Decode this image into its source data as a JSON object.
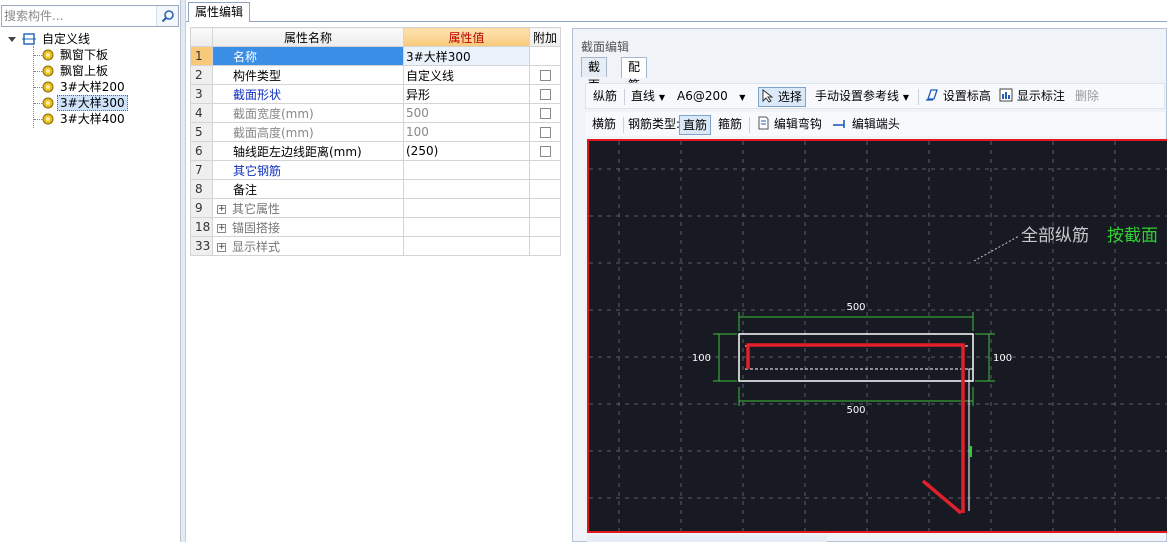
{
  "search": {
    "placeholder": "搜索构件..."
  },
  "tree": {
    "root_label": "自定义线",
    "items": [
      {
        "label": "飘窗下板"
      },
      {
        "label": "飘窗上板"
      },
      {
        "label": "3#大样200"
      },
      {
        "label": "3#大样300",
        "selected": true
      },
      {
        "label": "3#大样400"
      }
    ]
  },
  "tabs": {
    "property_edit": "属性编辑"
  },
  "grid": {
    "headers": {
      "name": "属性名称",
      "value": "属性值",
      "extra": "附加"
    },
    "rows": [
      {
        "num": "1",
        "name": "名称",
        "value": "3#大样300",
        "check": false
      },
      {
        "num": "2",
        "name": "构件类型",
        "value": "自定义线",
        "check": true
      },
      {
        "num": "3",
        "name": "截面形状",
        "value": "异形",
        "check": true
      },
      {
        "num": "4",
        "name": "截面宽度(mm)",
        "value": "500",
        "check": true
      },
      {
        "num": "5",
        "name": "截面高度(mm)",
        "value": "100",
        "check": true
      },
      {
        "num": "6",
        "name": "轴线距左边线距离(mm)",
        "value": "(250)",
        "check": true
      },
      {
        "num": "7",
        "name": "其它钢筋",
        "value": "",
        "check": false
      },
      {
        "num": "8",
        "name": "备注",
        "value": "",
        "check": false
      },
      {
        "num": "9",
        "name": "其它属性",
        "value": "",
        "check": false
      },
      {
        "num": "18",
        "name": "锚固搭接",
        "value": "",
        "check": false
      },
      {
        "num": "33",
        "name": "显示样式",
        "value": "",
        "check": false
      }
    ]
  },
  "section": {
    "title": "截面编辑",
    "tabs": [
      "截面",
      "配筋"
    ],
    "toolbar1": {
      "longitudinal": "纵筋",
      "line_mode": "直线",
      "rebar_spec": "A6@200",
      "select": "选择",
      "manual_ref": "手动设置参考线",
      "set_elevation": "设置标高",
      "show_label": "显示标注",
      "delete": "删除"
    },
    "toolbar2": {
      "transverse": "横筋",
      "rebar_type_label": "钢筋类型:",
      "straight": "直筋",
      "stirrup": "箍筋",
      "edit_hook": "编辑弯钩",
      "edit_end": "编辑端头"
    },
    "canvas": {
      "annotation_all": "全部纵筋",
      "annotation_by": "按截面",
      "dim_top": "500",
      "dim_bottom": "500",
      "dim_left": "100",
      "dim_right": "100",
      "colors": {
        "bg": "#171923",
        "grid": "#5a5e6a",
        "dim": "#3fbf3f",
        "rebar": "#e0202a",
        "outline": "#ffffff",
        "text_green": "#30d030",
        "text_gray": "#c8c8c8"
      }
    }
  }
}
